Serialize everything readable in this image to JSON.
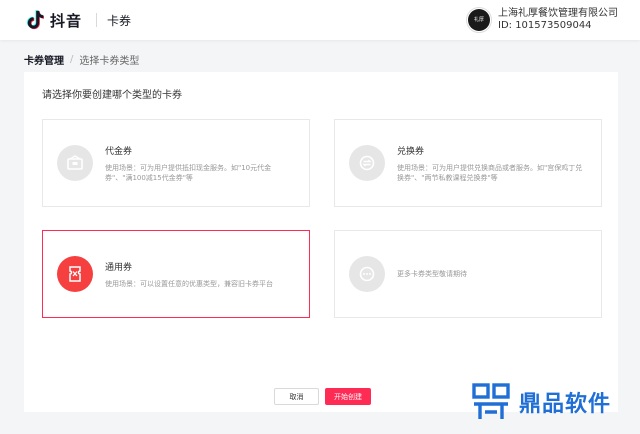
{
  "header": {
    "app_name": "抖音",
    "app_sub": "卡券",
    "account": {
      "avatar_text": "礼厚",
      "name": "上海礼厚餐饮管理有限公司",
      "id_text": "ID: 101573509044"
    }
  },
  "breadcrumb": {
    "parent": "卡券管理",
    "separator": "/",
    "current": "选择卡券类型"
  },
  "panel": {
    "title": "请选择你要创建哪个类型的卡券",
    "cards": [
      {
        "title": "代金券",
        "desc_line1": "使用场景：可为用户提供抵扣现金服务。如\"10元代金",
        "desc_line2": "券\"、\"满100减15代金券\"等",
        "icon": "voucher-icon",
        "selected": false
      },
      {
        "title": "兑换券",
        "desc_line1": "使用场景：可为用户提供兑换商品或者服务。如\"宫保鸡丁兑",
        "desc_line2": "换券\"、\"两节私教课程兑换券\"等",
        "icon": "exchange-icon",
        "selected": false
      },
      {
        "title": "通用券",
        "desc_line1": "使用场景：可以设置任意的优惠类型，兼容旧卡券平台",
        "desc_line2": "",
        "icon": "general-coupon-icon",
        "selected": true
      },
      {
        "title": "",
        "desc_line1": "更多卡券类型敬请期待",
        "icon": "more-icon",
        "selected": false
      }
    ]
  },
  "actions": {
    "cancel_label": "取消",
    "create_label": "开始创建"
  },
  "watermark": {
    "text": "鼎品软件"
  },
  "colors": {
    "accent": "#fe2c55",
    "selected_icon_bg": "#f5403f",
    "watermark": "#1f6fd6"
  }
}
